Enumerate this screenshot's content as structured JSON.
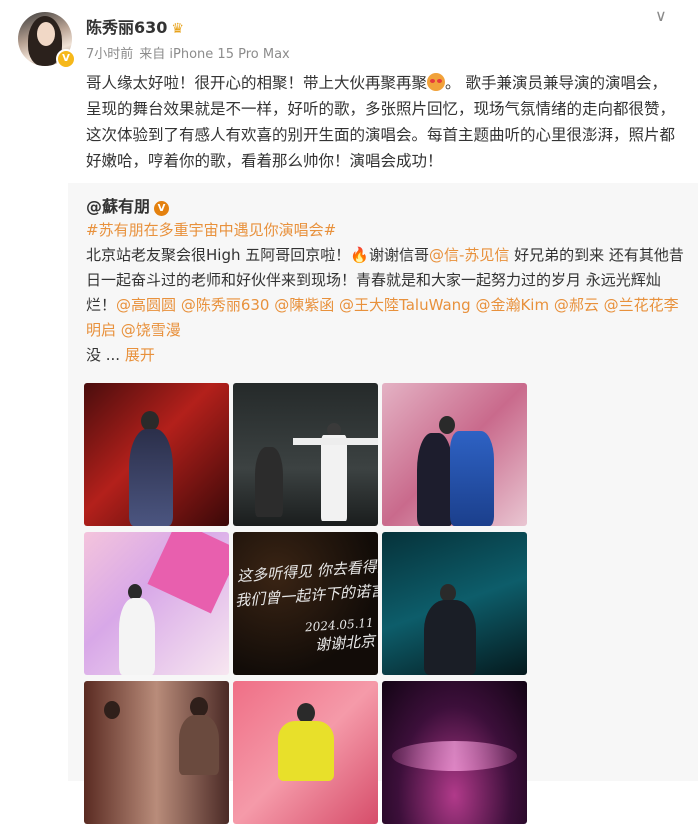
{
  "author": {
    "name": "陈秀丽630",
    "badge_glyph": "♛",
    "verified_glyph": "V",
    "time": "7小时前",
    "source": "来自 iPhone 15 Pro Max",
    "more_glyph": "∨"
  },
  "post": {
    "text_a": "哥人缘太好啦！很开心的相聚！带上大伙再聚再聚",
    "text_b": "。 歌手兼演员兼导演的演唱会，呈现的舞台效果就是不一样，好听的歌，多张照片回忆，现场气氛情绪的走向都很赞，这次体验到了有感人有欢喜的别开生面的演唱会。每首主题曲听的心里很澎湃，照片都好嫩哈，哼着你的歌，看着那么帅你！演唱会成功！"
  },
  "repost": {
    "author": "@蘇有朋",
    "verified_glyph": "V",
    "hashtag": "#苏有朋在多重宇宙中遇见你演唱会#",
    "t1": "北京站老友聚会很High 五阿哥回京啦！",
    "fire": "🔥",
    "t2": "谢谢信哥",
    "m1": "@信-苏见信",
    "t3": " 好兄弟的到来 还有其他昔日一起奋斗过的老师和好伙伴来到现场！青春就是和大家一起努力过的岁月 永远光辉灿烂！",
    "m2": "@高圆圆",
    "m3": "@陈秀丽630",
    "m4": "@陳紫函",
    "m5": "@王大陸TaluWang",
    "m6": "@金瀚Kim",
    "m7": "@郝云",
    "m8": "@兰花花李明启",
    "m9": "@饶雪漫",
    "t4": "没 ... ",
    "expand": "展开",
    "photo_handwriting": [
      "这多听得见 你去看得见",
      "我们曾一起许下的诺言！",
      "2024.05.11",
      "谢谢北京"
    ]
  },
  "colors": {
    "accent": "#e8913c",
    "repost_bg": "#f7f7f7",
    "meta": "#8c8c8c"
  }
}
